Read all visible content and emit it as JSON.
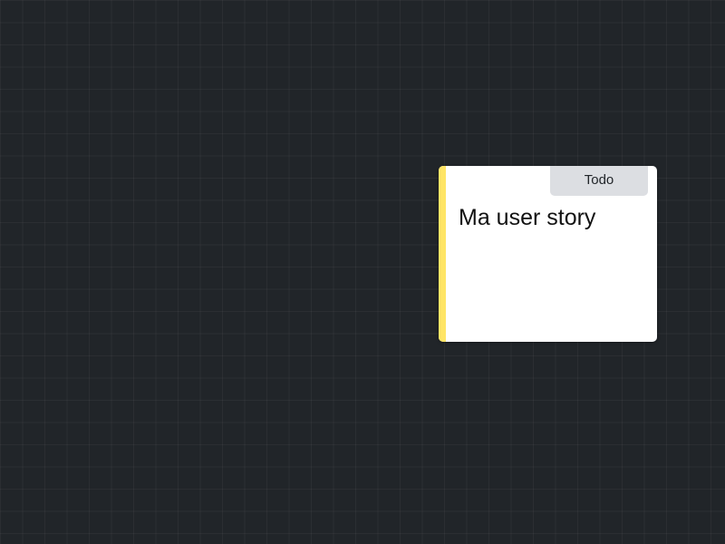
{
  "card": {
    "title": "Ma user story",
    "status": "Todo",
    "accent_color": "#ffe566"
  },
  "board": {
    "background_color": "#212529"
  }
}
